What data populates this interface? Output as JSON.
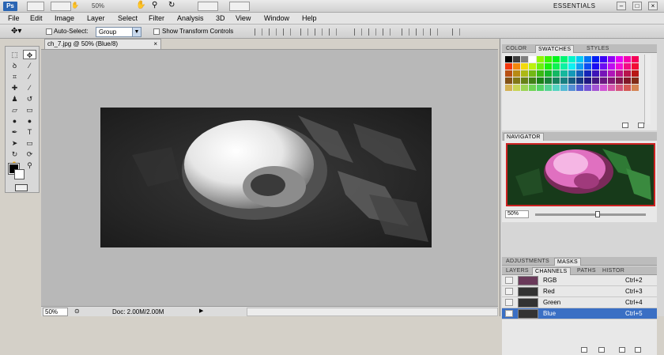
{
  "appbar": {
    "logo": "Ps",
    "zoom": "50%",
    "workspace": "ESSENTIALS",
    "win_min": "–",
    "win_max": "□",
    "win_close": "×"
  },
  "menu": [
    "File",
    "Edit",
    "Image",
    "Layer",
    "Select",
    "Filter",
    "Analysis",
    "3D",
    "View",
    "Window",
    "Help"
  ],
  "options": {
    "auto_select_label": "Auto-Select:",
    "group_value": "Group",
    "transform_label": "Show Transform Controls"
  },
  "document": {
    "tab_title": "ch_7.jpg @ 50% (Blue/8)",
    "tab_close": "×"
  },
  "status": {
    "zoom": "50%",
    "doc_info": "Doc: 2.00M/2.00M",
    "arrow": "▶"
  },
  "panels": {
    "swatch_tabs": [
      "COLOR",
      "SWATCHES",
      "STYLES"
    ],
    "navigator_title": "NAVIGATOR",
    "navigator_zoom": "50%",
    "adj_tabs": [
      "ADJUSTMENTS",
      "MASKS"
    ],
    "channel_tabs": [
      "LAYERS",
      "CHANNELS",
      "PATHS",
      "HISTOR"
    ],
    "channels": [
      {
        "name": "RGB",
        "shortcut": "Ctrl+2"
      },
      {
        "name": "Red",
        "shortcut": "Ctrl+3"
      },
      {
        "name": "Green",
        "shortcut": "Ctrl+4"
      },
      {
        "name": "Blue",
        "shortcut": "Ctrl+5"
      }
    ]
  },
  "colors": {
    "selection_blue": "#3a6fc4",
    "ps_logo_blue": "#2a65b3",
    "navigator_border": "#cc2222"
  }
}
